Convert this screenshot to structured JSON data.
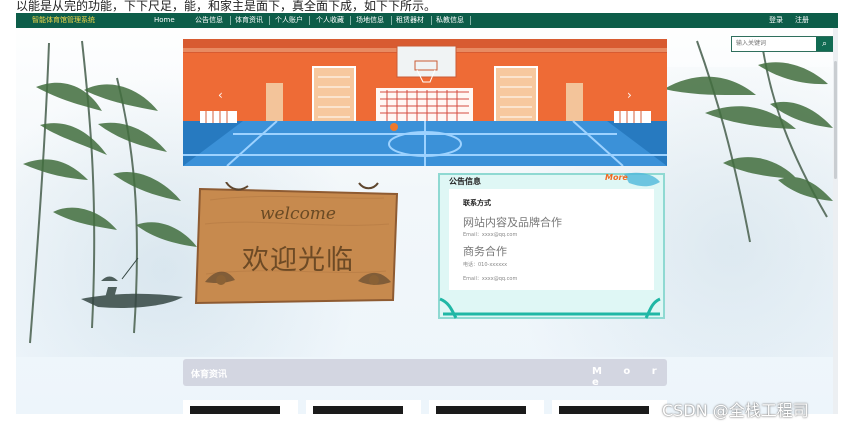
{
  "top_caption": "以能是从完的功能，下下尺足，能，和家主是面下，真全面下成，如下下所示。",
  "navbar": {
    "brand": "智能体育馆管理系统",
    "links": [
      "Home",
      "公告信息",
      "体育资讯",
      "个人账户",
      "个人收藏",
      "场地信息",
      "租赁器材",
      "私教信息"
    ],
    "login": "登录",
    "register": "注册",
    "bg_color": "#0d5d49",
    "brand_color": "#f1d74a"
  },
  "search": {
    "placeholder": "输入关键词",
    "icon": "search-icon"
  },
  "banner": {
    "prev_icon": "‹",
    "next_icon": "›",
    "dot_count": 3
  },
  "welcome_sign": {
    "english": "welcome",
    "chinese": "欢迎光临"
  },
  "notice": {
    "title": "公告信息",
    "more": "More",
    "contact_heading": "联系方式",
    "website_cooperation": "网站内容及品牌合作",
    "email_label_1": "Email：xxxx@qq.com",
    "business_cooperation": "商务合作",
    "phone_label": "电话：010-xxxxxx",
    "email_label_2": "Email：xxxx@qq.com"
  },
  "sports": {
    "title": "体育资讯",
    "more": "M o r e",
    "thumb_count": 4
  },
  "watermark": "CSDN @全栈工程司"
}
